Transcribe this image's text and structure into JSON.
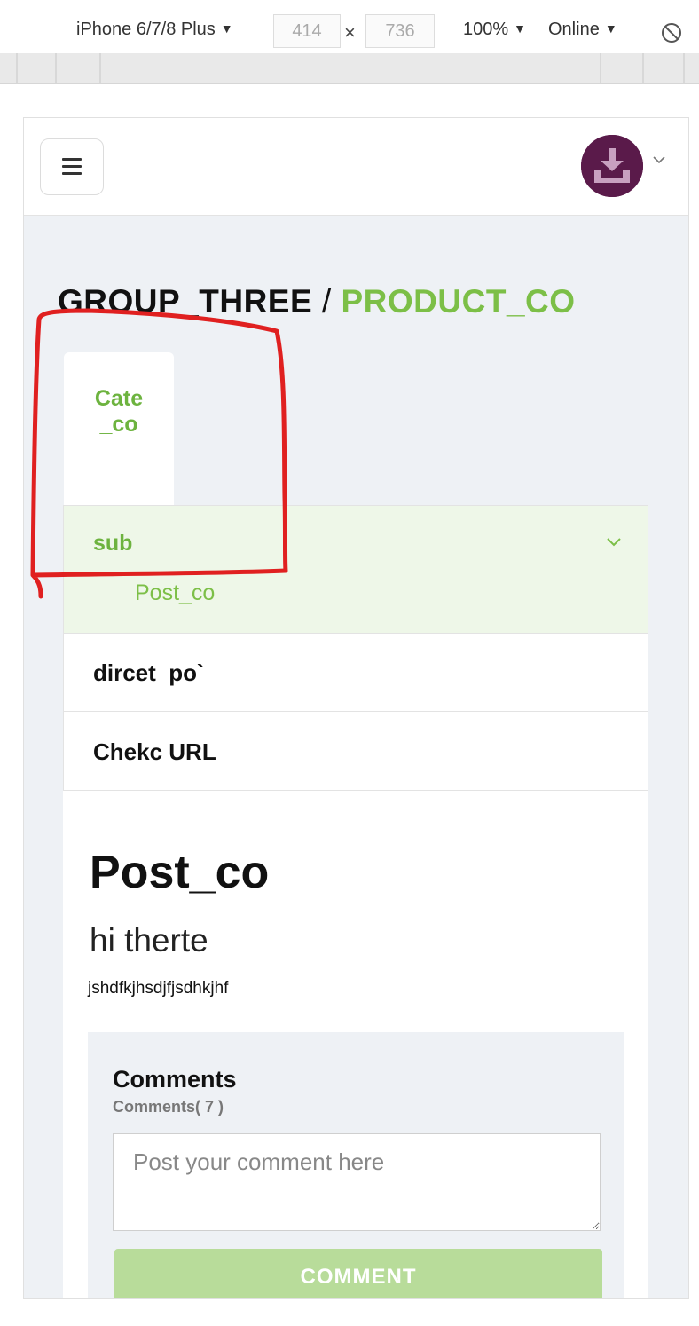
{
  "devtools": {
    "device": "iPhone 6/7/8 Plus",
    "width": "414",
    "times": "×",
    "height": "736",
    "zoom": "100%",
    "network": "Online",
    "caret": "▼"
  },
  "breadcrumb": {
    "group": "GROUP_THREE",
    "separator": " / ",
    "product": "PRODUCT_CO"
  },
  "category_tab": {
    "label": "Cate_co"
  },
  "nav": {
    "sub": {
      "label": "sub",
      "child": "Post_co"
    },
    "items": [
      {
        "label": "dircet_po`"
      },
      {
        "label": "Chekc URL"
      }
    ]
  },
  "post": {
    "title": "Post_co",
    "subtitle": "hi therte",
    "body": "jshdfkjhsdjfjsdhkjhf"
  },
  "comments": {
    "heading": "Comments",
    "count_text": "Comments( 7 )",
    "placeholder": "Post your comment here",
    "button_label": "COMMENT"
  },
  "colors": {
    "accent_green": "#6db33f",
    "active_bg": "#eef7e8",
    "button_green": "#b8dc9a",
    "avatar": "#5a1a4a",
    "annotation_red": "#e02020"
  },
  "icons": [
    "hamburger-icon",
    "avatar-icon",
    "chevron-down-icon",
    "rotate-icon"
  ]
}
